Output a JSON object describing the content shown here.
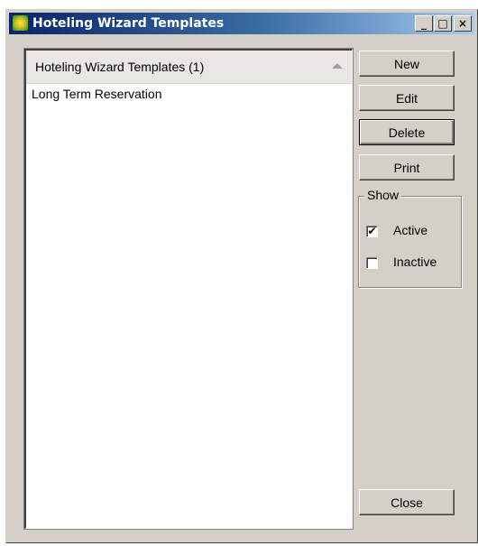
{
  "window": {
    "title": "Hoteling Wizard Templates",
    "minimize_glyph": "_",
    "maximize_glyph": "□",
    "close_glyph": "×"
  },
  "list": {
    "header": "Hoteling Wizard Templates (1)",
    "rows": [
      "Long Term Reservation"
    ]
  },
  "buttons": {
    "new": "New",
    "edit": "Edit",
    "delete": "Delete",
    "print": "Print",
    "close": "Close"
  },
  "show": {
    "label": "Show",
    "active_label": "Active",
    "active_checked": true,
    "inactive_label": "Inactive",
    "inactive_checked": false
  },
  "icons": {
    "app": "hoteling-app-icon",
    "sort": "sort-ascending-icon"
  }
}
